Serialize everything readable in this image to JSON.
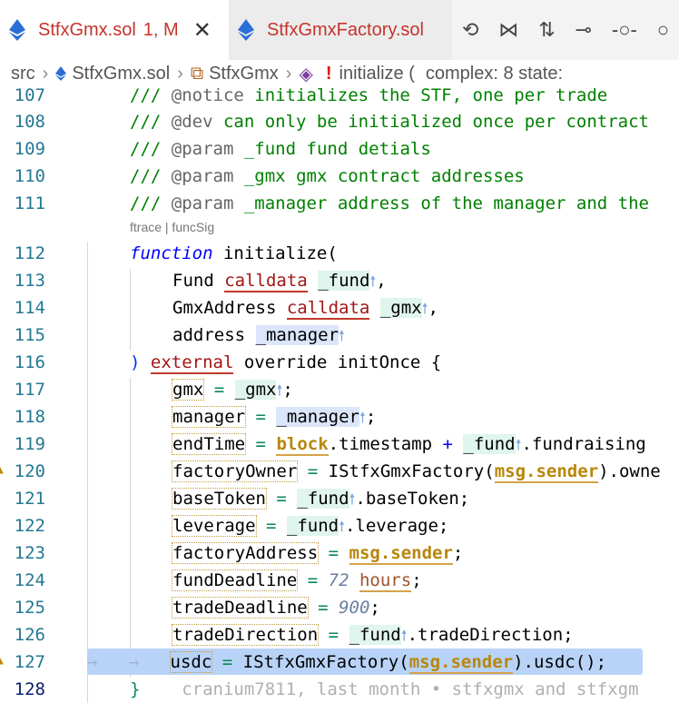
{
  "tabs": [
    {
      "title": "StfxGmx.sol",
      "status": "1, M",
      "active": true
    },
    {
      "title": "StfxGmxFactory.sol",
      "active": false
    }
  ],
  "actions": [
    "history-icon",
    "graph-icon",
    "compare-icon",
    "commit-icon",
    "commit-next-icon",
    "commit-last-icon"
  ],
  "breadcrumb": {
    "root": "src",
    "file": "StfxGmx.sol",
    "contract": "StfxGmx",
    "func": "initialize (",
    "extra": "complex: 8 state:"
  },
  "lens": "ftrace | funcSig",
  "blame": "cranium7811, last month • stfxgmx and stfxgm",
  "lines": [
    {
      "n": "107"
    },
    {
      "n": "108"
    },
    {
      "n": "109"
    },
    {
      "n": "110"
    },
    {
      "n": "111"
    },
    {
      "n": "112"
    },
    {
      "n": "113"
    },
    {
      "n": "114"
    },
    {
      "n": "115"
    },
    {
      "n": "116"
    },
    {
      "n": "117"
    },
    {
      "n": "118"
    },
    {
      "n": "119"
    },
    {
      "n": "120"
    },
    {
      "n": "121"
    },
    {
      "n": "122"
    },
    {
      "n": "123"
    },
    {
      "n": "124"
    },
    {
      "n": "125"
    },
    {
      "n": "126"
    },
    {
      "n": "127"
    },
    {
      "n": "128"
    }
  ],
  "code": {
    "l107_tag": "@notice",
    "l107_text": " initializes the STF, one per trade",
    "l108_tag": "@dev",
    "l108_text": " can only be initialized once per contract",
    "l109_tag": "@param",
    "l109_text": " fund detials",
    "l109_var": "_fund",
    "l110_tag": "@param",
    "l110_var": "_gmx",
    "l110_text": " gmx contract addresses",
    "l111_tag": "@param",
    "l111_var": "_manager",
    "l111_text": " address of the manager and the",
    "comment_prefix": "/// ",
    "kw_function": "function",
    "fn_name": " initialize(",
    "type_fund": "Fund",
    "calldata": "calldata",
    "v_fund": "_fund",
    "type_gmx": "GmxAddress",
    "v_gmx": "_gmx",
    "type_address": "address",
    "v_manager": "_manager",
    "kw_external": "external",
    "override": " override initOnce {",
    "s_gmx": "gmx",
    "s_manager": "manager",
    "s_endTime": "endTime",
    "block": "block",
    "timestamp": ".timestamp",
    "fundraising": ".fundraising",
    "s_factoryOwner": "factoryOwner",
    "iface": "IStfxGmxFactory",
    "msg_sender": "msg.sender",
    "owne": ").owne",
    "s_baseToken": "baseToken",
    "baseToken_tail": ".baseToken;",
    "s_leverage": "leverage",
    "leverage_tail": ".leverage;",
    "s_factoryAddress": "factoryAddress",
    "s_fundDeadline": "fundDeadline",
    "n72": "72",
    "hours": "hours",
    "s_tradeDeadline": "tradeDeadline",
    "n900": "900",
    "s_tradeDirection": "tradeDirection",
    "tradeDirection_tail": ".tradeDirection;",
    "s_usdc": "usdc",
    "usdc_tail": ").usdc();",
    "close_brace": "}"
  }
}
